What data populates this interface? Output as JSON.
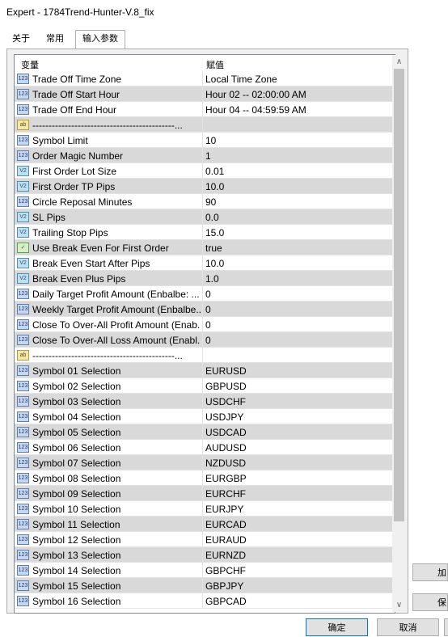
{
  "window": {
    "title": "Expert - 1784Trend-Hunter-V.8_fix"
  },
  "tabs": [
    {
      "label": "关于"
    },
    {
      "label": "常用"
    },
    {
      "label": "输入参数"
    }
  ],
  "grid": {
    "col_variable": "变量",
    "col_value": "赋值",
    "rows": [
      {
        "icon": "123",
        "name": "Trade Off Time Zone",
        "value": "Local Time Zone"
      },
      {
        "icon": "123",
        "name": "Trade Off Start Hour",
        "value": "Hour 02   --   02:00:00 AM"
      },
      {
        "icon": "123",
        "name": "Trade Off End Hour",
        "value": "Hour 04   --   04:59:59 AM"
      },
      {
        "icon": "ab",
        "name": "--------------------------------------------...",
        "value": ""
      },
      {
        "icon": "123",
        "name": "Symbol Limit",
        "value": "10"
      },
      {
        "icon": "123",
        "name": "Order Magic Number",
        "value": "1"
      },
      {
        "icon": "v2",
        "name": "First Order Lot Size",
        "value": "0.01"
      },
      {
        "icon": "v2",
        "name": "First Order TP Pips",
        "value": "10.0"
      },
      {
        "icon": "123",
        "name": "Circle Reposal Minutes",
        "value": "90"
      },
      {
        "icon": "v2",
        "name": "SL Pips",
        "value": "0.0"
      },
      {
        "icon": "v2",
        "name": "Trailing Stop Pips",
        "value": "15.0"
      },
      {
        "icon": "ok",
        "name": "Use Break Even For First Order",
        "value": "true"
      },
      {
        "icon": "v2",
        "name": "Break Even Start After Pips",
        "value": "10.0"
      },
      {
        "icon": "v2",
        "name": "Break Even Plus Pips",
        "value": "1.0"
      },
      {
        "icon": "123",
        "name": "Daily Target Profit Amount (Enbalbe: ...",
        "value": "0"
      },
      {
        "icon": "123",
        "name": "Weekly Target Profit Amount (Enbalbe...",
        "value": "0"
      },
      {
        "icon": "123",
        "name": "Close To Over-All Profit Amount (Enab...",
        "value": "0"
      },
      {
        "icon": "123",
        "name": "Close To Over-All Loss Amount (Enabl...",
        "value": "0"
      },
      {
        "icon": "ab",
        "name": "--------------------------------------------...",
        "value": ""
      },
      {
        "icon": "123",
        "name": "Symbol 01 Selection",
        "value": "EURUSD"
      },
      {
        "icon": "123",
        "name": "Symbol 02 Selection",
        "value": "GBPUSD"
      },
      {
        "icon": "123",
        "name": "Symbol 03 Selection",
        "value": "USDCHF"
      },
      {
        "icon": "123",
        "name": "Symbol 04 Selection",
        "value": "USDJPY"
      },
      {
        "icon": "123",
        "name": "Symbol 05 Selection",
        "value": "USDCAD"
      },
      {
        "icon": "123",
        "name": "Symbol 06 Selection",
        "value": "AUDUSD"
      },
      {
        "icon": "123",
        "name": "Symbol 07 Selection",
        "value": "NZDUSD"
      },
      {
        "icon": "123",
        "name": "Symbol 08 Selection",
        "value": "EURGBP"
      },
      {
        "icon": "123",
        "name": "Symbol 09 Selection",
        "value": "EURCHF"
      },
      {
        "icon": "123",
        "name": "Symbol 10 Selection",
        "value": "EURJPY"
      },
      {
        "icon": "123",
        "name": "Symbol 11 Selection",
        "value": "EURCAD"
      },
      {
        "icon": "123",
        "name": "Symbol 12 Selection",
        "value": "EURAUD"
      },
      {
        "icon": "123",
        "name": "Symbol 13 Selection",
        "value": "EURNZD"
      },
      {
        "icon": "123",
        "name": "Symbol 14 Selection",
        "value": "GBPCHF"
      },
      {
        "icon": "123",
        "name": "Symbol 15 Selection",
        "value": "GBPJPY"
      },
      {
        "icon": "123",
        "name": "Symbol 16 Selection",
        "value": "GBPCAD"
      }
    ]
  },
  "side_buttons": {
    "load": "加",
    "save": "保"
  },
  "footer": {
    "ok": "确定",
    "cancel": "取消"
  }
}
